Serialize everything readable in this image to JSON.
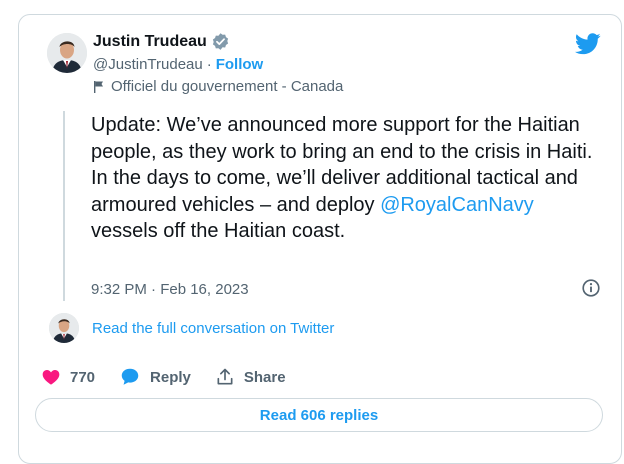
{
  "author": {
    "name": "Justin Trudeau",
    "handle": "@JustinTrudeau",
    "separator": "·",
    "follow_label": "Follow",
    "affiliation_label": "Officiel du gouvernement - Canada"
  },
  "tweet": {
    "text_before_mention": "Update: We’ve announced more support for the Haitian people, as they work to bring an end to the crisis in Haiti. In the days to come, we’ll deliver additional tactical and armoured vehicles – and deploy ",
    "mention": "@RoyalCanNavy",
    "text_after_mention": " vessels off the Haitian coast.",
    "timestamp": "9:32 PM · Feb 16, 2023"
  },
  "thread": {
    "read_conversation_label": "Read the full conversation on Twitter"
  },
  "actions": {
    "like_count": "770",
    "reply_label": "Reply",
    "share_label": "Share"
  },
  "read_replies_label": "Read 606 replies",
  "colors": {
    "accent": "#1d9bf0",
    "like": "#f91880",
    "text": "#0f1419",
    "muted": "#536471",
    "border": "#cfd9de"
  },
  "icons": {
    "verified": "verified-badge-icon",
    "brand": "twitter-bird-icon",
    "affiliation": "flag-icon",
    "info": "info-icon",
    "like": "heart-icon",
    "reply": "speech-bubble-icon",
    "share": "share-upload-icon"
  }
}
